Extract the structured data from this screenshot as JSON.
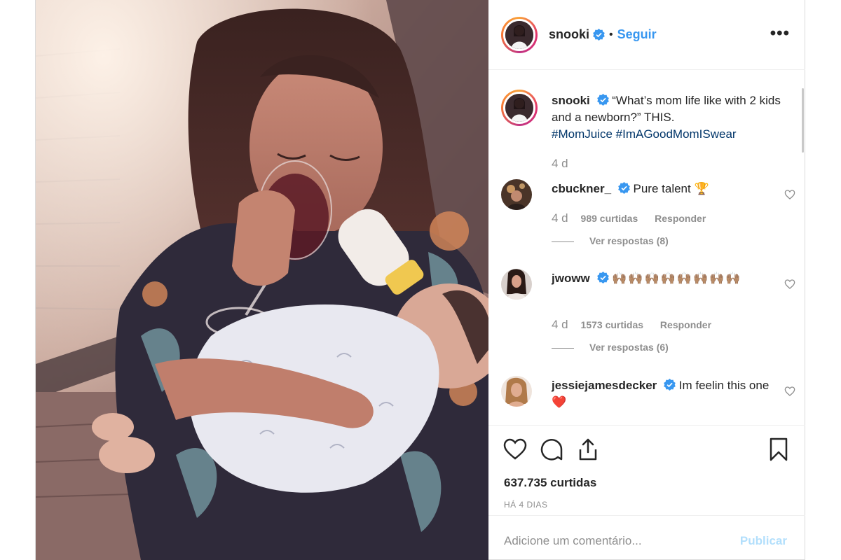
{
  "header": {
    "username": "snooki",
    "separator": "•",
    "follow_label": "Seguir",
    "more_icon": "more-options-icon"
  },
  "caption": {
    "username": "snooki",
    "text": "“What’s mom life like with 2 kids and a newborn?” THIS.",
    "hashtags": "#MomJuice #ImAGoodMomISwear",
    "time": "4 d"
  },
  "comments": [
    {
      "username": "cbuckner_",
      "text": "Pure talent 🏆",
      "time": "4 d",
      "likes": "989 curtidas",
      "reply_label": "Responder",
      "view_replies": "Ver respostas (8)"
    },
    {
      "username": "jwoww",
      "text": "🙌🏽🙌🏽🙌🏽🙌🏽🙌🏽🙌🏽🙌🏽🙌🏽",
      "time": "4 d",
      "likes": "1573 curtidas",
      "reply_label": "Responder",
      "view_replies": "Ver respostas (6)"
    },
    {
      "username": "jessiejamesdecker",
      "text": "Im feelin this one ❤️"
    }
  ],
  "footer": {
    "likes": "637.735 curtidas",
    "date": "HÁ 4 DIAS",
    "comment_placeholder": "Adicione um comentário...",
    "publish_label": "Publicar"
  },
  "colors": {
    "link_blue": "#3897f0",
    "hashtag": "#003569",
    "muted": "#8e8e8e",
    "publish_disabled": "#b2dffc"
  }
}
